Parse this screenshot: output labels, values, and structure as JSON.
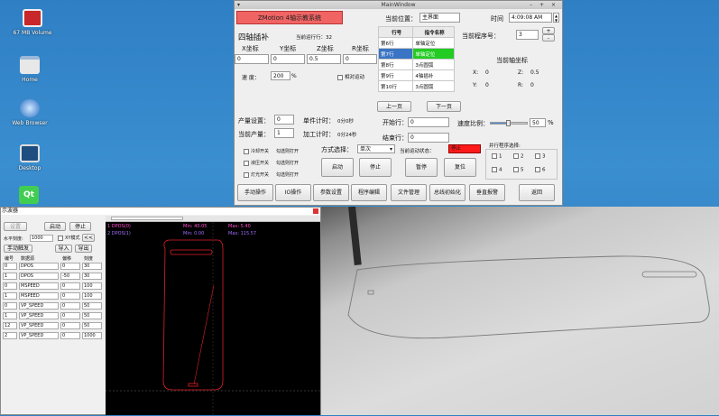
{
  "desktop": {
    "icons": [
      {
        "label": "67 MB Volume"
      },
      {
        "label": "Home"
      },
      {
        "label": "Web Browser"
      },
      {
        "label": "Desktop"
      },
      {
        "label": "Qt"
      }
    ]
  },
  "mainwin": {
    "title": "MainWindow",
    "banner": "ZMotion    4轴示教系统",
    "current_pos_label": "当前位置：",
    "current_pos_value": "主界面",
    "time_label": "时间",
    "time_value": "4:09:08 AM",
    "current_program_label": "当前程序号：",
    "current_program_value": "3",
    "section_title": "四轴插补",
    "current_run_line": "当前运行行：32",
    "axis_labels": [
      "X坐标",
      "Y坐标",
      "Z坐标",
      "R坐标"
    ],
    "axis_values": [
      "0",
      "0",
      "0.5",
      "0"
    ],
    "speed_label": "速    度：",
    "speed_value": "200",
    "speed_unit": "%",
    "relative_label": "相对运动",
    "table_headers": [
      "行号",
      "指令名称"
    ],
    "table_rows": [
      {
        "line": "第6行",
        "cmd": "单轴定位",
        "state": "normal"
      },
      {
        "line": "第7行",
        "cmd": "单轴定位",
        "state": "selected"
      },
      {
        "line": "第8行",
        "cmd": "3点圆弧",
        "state": "normal"
      },
      {
        "line": "第9行",
        "cmd": "4轴插补",
        "state": "normal"
      },
      {
        "line": "第10行",
        "cmd": "3点圆弧",
        "state": "normal"
      }
    ],
    "prev_page": "上一页",
    "next_page": "下一页",
    "current_axis_title": "当前轴坐标",
    "axis_readout": {
      "x_label": "X:",
      "x": "0",
      "z_label": "Z:",
      "z": "0.5",
      "y_label": "Y:",
      "y": "0",
      "r_label": "R:",
      "r": "0"
    },
    "output_setting_label": "产量设置：",
    "output_setting_value": "0",
    "current_output_label": "当前产量：",
    "current_output_value": "1",
    "single_timer_label": "单件计时：",
    "single_timer_value": "0分0秒",
    "process_timer_label": "加工计时：",
    "process_timer_value": "0分24秒",
    "start_line_label": "开始行：",
    "start_line_value": "0",
    "end_line_label": "结束行：",
    "end_line_value": "0",
    "speed_ratio_label": "速度比例：",
    "speed_ratio_value": "50",
    "speed_ratio_unit": "%",
    "speed_ratio_fraction": 0.5,
    "checks": [
      {
        "label": "冷却开关",
        "hint": "勾选则打开"
      },
      {
        "label": "液压开关",
        "hint": "勾选则打开"
      },
      {
        "label": "灯光开关",
        "hint": "勾选则打开"
      }
    ],
    "mode_label": "方式选择：",
    "mode_value": "单次",
    "motion_state_label": "当前运动状态：",
    "motion_state_value": "停止",
    "motion_state_color": "#ff1a1a",
    "run_buttons": [
      "启动",
      "停止",
      "暂停",
      "复位"
    ],
    "parallel_label": "并行程序选择:",
    "parallel_items": [
      "1",
      "2",
      "3",
      "4",
      "5",
      "6"
    ],
    "bottom_buttons": [
      "手动操作",
      "IO操作",
      "参数设置",
      "程序编辑",
      "文件管理",
      "总线初始化",
      "垂直报警",
      "返回"
    ]
  },
  "scope": {
    "title": "示波器",
    "btn_setup": "设置",
    "btn_start": "启动",
    "btn_stop": "停止",
    "h_scale_label": "水平刻度:",
    "h_scale_value": "1000",
    "xy_mode_label": "XY模式",
    "xy_mode_arrow": "<<",
    "manual_trigger": "手动触发",
    "import": "导入",
    "export": "导出",
    "col_headers": [
      "编号",
      "数据源",
      "偏移",
      "刻度"
    ],
    "rows": [
      {
        "num": "0",
        "src": "DPOS",
        "offset": "0",
        "scale": "30"
      },
      {
        "num": "1",
        "src": "DPOS",
        "offset": "-50",
        "scale": "30"
      },
      {
        "num": "0",
        "src": "MSPEED",
        "offset": "0",
        "scale": "100"
      },
      {
        "num": "1",
        "src": "MSPEED",
        "offset": "0",
        "scale": "100"
      },
      {
        "num": "0",
        "src": "VP_SPEED",
        "offset": "0",
        "scale": "50"
      },
      {
        "num": "1",
        "src": "VP_SPEED",
        "offset": "0",
        "scale": "50"
      },
      {
        "num": "12",
        "src": "VP_SPEED",
        "offset": "0",
        "scale": "50"
      },
      {
        "num": "2",
        "src": "VP_SPEED",
        "offset": "0",
        "scale": "1000"
      }
    ],
    "plot": {
      "legend1": "1 DPOS(0)",
      "legend2": "2 DPOS(1)",
      "min1": "Min: 40.05",
      "max1": "Max: 5.40",
      "min2": "Min: 0.00",
      "max2": "Max: 115.57",
      "trace_color": "#e0202a"
    }
  }
}
